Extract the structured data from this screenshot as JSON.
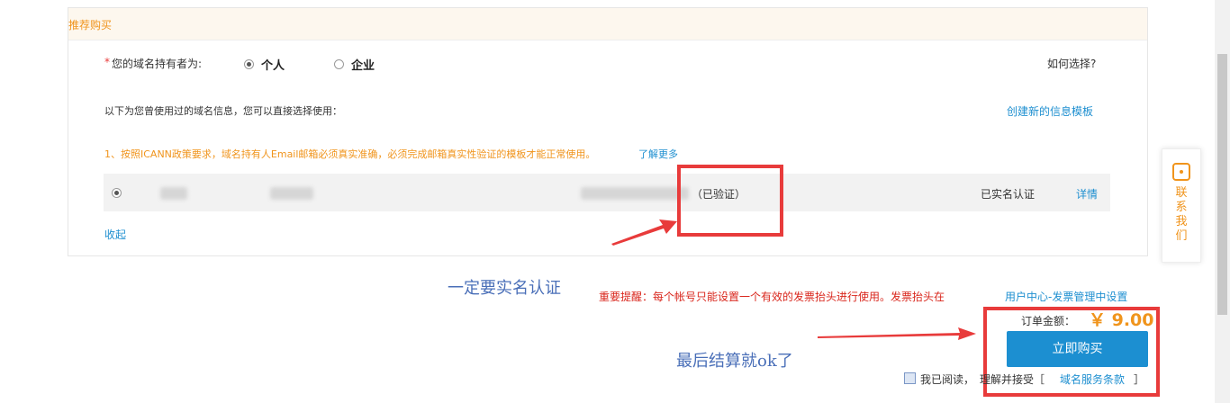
{
  "section": {
    "title": "推荐购买"
  },
  "owner": {
    "required_mark": "*",
    "label": "您的域名持有者为:",
    "options": [
      "个人",
      "企业"
    ],
    "selected": "个人",
    "help_link": "如何选择?"
  },
  "template": {
    "intro": "以下为您曾使用过的域名信息，您可以直接选择使用：",
    "create_link": "创建新的信息模板",
    "notice": "1、按照ICANN政策要求，域名持有人Email邮箱必须真实准确，必须完成邮箱真实性验证的模板才能正常使用。",
    "learn_more": "了解更多",
    "row": {
      "verified": "（已验证）",
      "status": "已实名认证",
      "detail_link": "详情"
    },
    "collapse": "收起"
  },
  "annotations": {
    "note1": "一定要实名认证",
    "note2": "最后结算就ok了"
  },
  "invoice": {
    "warning": "重要提醒：每个帐号只能设置一个有效的发票抬头进行使用。发票抬头在",
    "link": "用户中心-发票管理中设置"
  },
  "order": {
    "amount_label": "订单金额：",
    "amount": "￥ 9.00",
    "buy_button": "立即购买",
    "agree_prefix": "我已阅读，",
    "agree_middle": "理解并接受［",
    "terms_link": "域名服务条款",
    "agree_suffix": "］"
  },
  "side": {
    "contact": "联系我们"
  },
  "colors": {
    "accent_orange": "#f0941c",
    "link_blue": "#1e8fd0",
    "annotation_red": "#e83b3b",
    "button_blue": "#1c8fd1"
  }
}
